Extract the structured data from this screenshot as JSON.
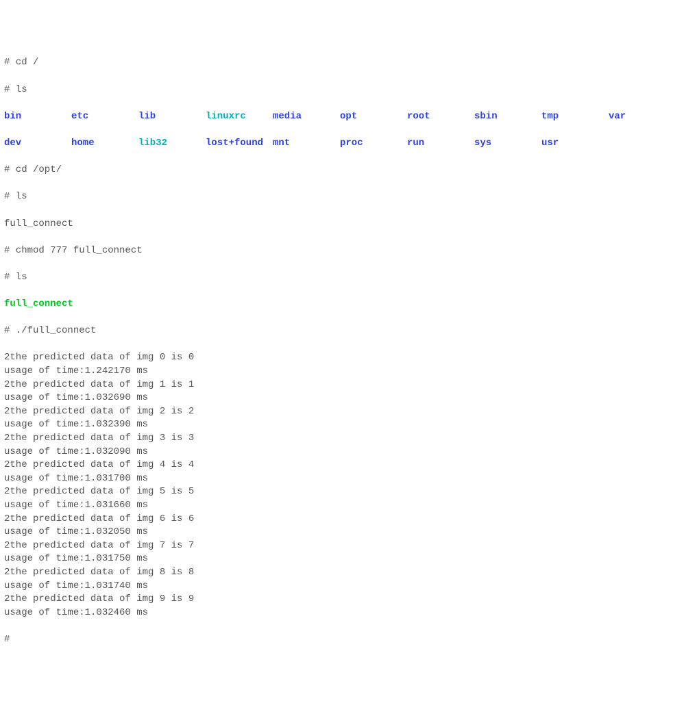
{
  "lines": {
    "cmd_cd_root": "# cd /",
    "cmd_ls1": "# ls",
    "cmd_cd_opt": "# cd /opt/",
    "cmd_ls2": "# ls",
    "out_full_connect": "full_connect",
    "cmd_chmod": "# chmod 777 full_connect",
    "cmd_ls3": "# ls",
    "out_full_connect_green": "full_connect",
    "cmd_run": "# ./full_connect",
    "final_prompt": "#"
  },
  "ls_root": {
    "row1": [
      {
        "name": "bin",
        "cls": "blue"
      },
      {
        "name": "etc",
        "cls": "blue"
      },
      {
        "name": "lib",
        "cls": "blue"
      },
      {
        "name": "linuxrc",
        "cls": "cyan"
      },
      {
        "name": "media",
        "cls": "blue"
      },
      {
        "name": "opt",
        "cls": "blue"
      },
      {
        "name": "root",
        "cls": "blue"
      },
      {
        "name": "sbin",
        "cls": "blue"
      },
      {
        "name": "tmp",
        "cls": "blue"
      },
      {
        "name": "var",
        "cls": "blue"
      }
    ],
    "row2": [
      {
        "name": "dev",
        "cls": "blue"
      },
      {
        "name": "home",
        "cls": "blue"
      },
      {
        "name": "lib32",
        "cls": "cyan"
      },
      {
        "name": "lost+found",
        "cls": "blue"
      },
      {
        "name": "mnt",
        "cls": "blue"
      },
      {
        "name": "proc",
        "cls": "blue"
      },
      {
        "name": "run",
        "cls": "blue"
      },
      {
        "name": "sys",
        "cls": "blue"
      },
      {
        "name": "usr",
        "cls": "blue"
      }
    ]
  },
  "predictions": [
    {
      "img": 0,
      "pred": 0,
      "time": "1.242170"
    },
    {
      "img": 1,
      "pred": 1,
      "time": "1.032690"
    },
    {
      "img": 2,
      "pred": 2,
      "time": "1.032390"
    },
    {
      "img": 3,
      "pred": 3,
      "time": "1.032090"
    },
    {
      "img": 4,
      "pred": 4,
      "time": "1.031700"
    },
    {
      "img": 5,
      "pred": 5,
      "time": "1.031660"
    },
    {
      "img": 6,
      "pred": 6,
      "time": "1.032050"
    },
    {
      "img": 7,
      "pred": 7,
      "time": "1.031750"
    },
    {
      "img": 8,
      "pred": 8,
      "time": "1.031740"
    },
    {
      "img": 9,
      "pred": 9,
      "time": "1.032460"
    }
  ]
}
